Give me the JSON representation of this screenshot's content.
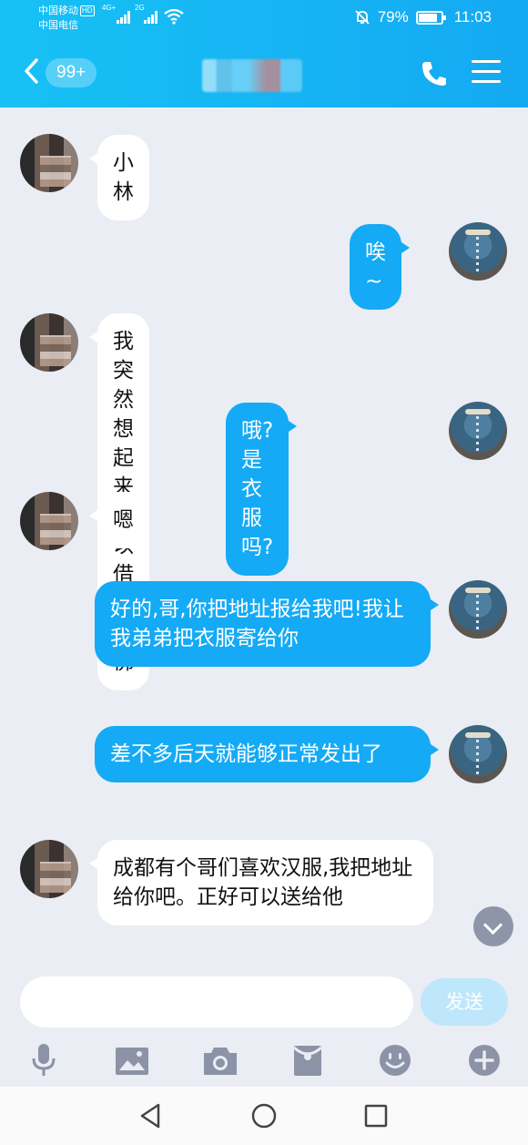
{
  "status_bar": {
    "carrier_1": "中国移动",
    "carrier_1_badge": "HD",
    "carrier_2": "中国电信",
    "network_1": "4G+",
    "network_2": "2G",
    "battery": "79%",
    "time": "11:03"
  },
  "header": {
    "unread_count": "99+"
  },
  "messages": [
    {
      "from": "other",
      "text": "小林"
    },
    {
      "from": "me",
      "text": "唉~"
    },
    {
      "from": "other",
      "text": "我突然想起来可以借花献佛"
    },
    {
      "from": "me",
      "text": "哦?是衣服吗?"
    },
    {
      "from": "other",
      "text": "嗯"
    },
    {
      "from": "me",
      "text": "好的,哥,你把地址报给我吧!我让我弟弟把衣服寄给你"
    },
    {
      "from": "me",
      "text": "差不多后天就能够正常发出了"
    },
    {
      "from": "other",
      "text": "成都有个哥们喜欢汉服,我把地址给你吧。正好可以送给他"
    }
  ],
  "composer": {
    "value": "",
    "send_label": "发送"
  },
  "toolbar_icons": [
    "microphone-icon",
    "image-icon",
    "camera-icon",
    "red-packet-icon",
    "emoji-icon",
    "plus-icon"
  ],
  "colors": {
    "header": "#14a9f2",
    "outgoing_bubble": "#14aaf5",
    "incoming_bubble": "#ffffff",
    "chat_background": "#eaedf4",
    "toolbar_icon": "#8d93a6"
  }
}
